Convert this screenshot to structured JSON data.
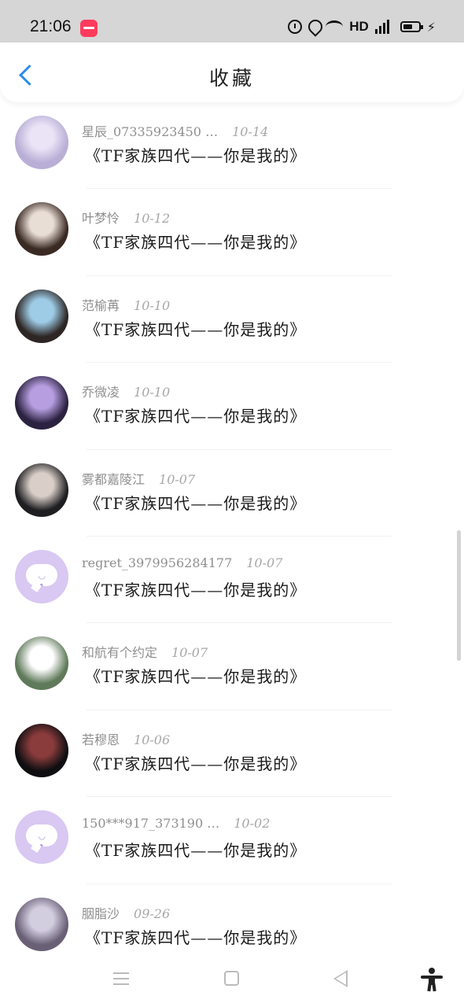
{
  "status_bar": {
    "time": "21:06",
    "network": "HD",
    "icons": [
      "app-badge-icon",
      "alarm-icon",
      "location-icon",
      "wifi-icon",
      "signal-4g-icon",
      "battery-charging-icon"
    ]
  },
  "header": {
    "title": "收藏",
    "back_icon": "chevron-left-icon",
    "accent_color": "#2a8cf0"
  },
  "items": [
    {
      "name": "星辰_07335923450 …",
      "date": "10-14",
      "title": "《TF家族四代——你是我的》",
      "avatar": "photo",
      "avatar_colors": [
        "#b9aed6",
        "#ebe4f7"
      ]
    },
    {
      "name": "叶梦怜",
      "date": "10-12",
      "title": "《TF家族四代——你是我的》",
      "avatar": "photo",
      "avatar_colors": [
        "#3a2a24",
        "#e9ded6"
      ]
    },
    {
      "name": "范榆苒",
      "date": "10-10",
      "title": "《TF家族四代——你是我的》",
      "avatar": "photo",
      "avatar_colors": [
        "#2d2624",
        "#9ecbe6"
      ]
    },
    {
      "name": "乔微凌",
      "date": "10-10",
      "title": "《TF家族四代——你是我的》",
      "avatar": "photo",
      "avatar_colors": [
        "#2b2140",
        "#b69ee0"
      ]
    },
    {
      "name": "雾都嘉陵江",
      "date": "10-07",
      "title": "《TF家族四代——你是我的》",
      "avatar": "photo",
      "avatar_colors": [
        "#1f1f22",
        "#d9cfc8"
      ]
    },
    {
      "name": "regret_3979956284177",
      "date": "10-07",
      "title": "《TF家族四代——你是我的》",
      "avatar": "default-chat",
      "avatar_colors": [
        "#d8c8f2",
        "#ffffff"
      ]
    },
    {
      "name": "和航有个约定",
      "date": "10-07",
      "title": "《TF家族四代——你是我的》",
      "avatar": "photo",
      "avatar_colors": [
        "#5f7a5a",
        "#ffffff"
      ]
    },
    {
      "name": "若穆恩",
      "date": "10-06",
      "title": "《TF家族四代——你是我的》",
      "avatar": "photo",
      "avatar_colors": [
        "#0f0f12",
        "#8a3b3b"
      ]
    },
    {
      "name": "150***917_373190 …",
      "date": "10-02",
      "title": "《TF家族四代——你是我的》",
      "avatar": "default-chat",
      "avatar_colors": [
        "#d8c8f2",
        "#ffffff"
      ]
    },
    {
      "name": "胭脂沙",
      "date": "09-26",
      "title": "《TF家族四代——你是我的》",
      "avatar": "photo",
      "avatar_colors": [
        "#6a6076",
        "#d3cde0"
      ]
    }
  ],
  "nav_bar": {
    "icons": [
      "menu-icon",
      "home-square-icon",
      "back-triangle-icon",
      "accessibility-icon"
    ]
  }
}
